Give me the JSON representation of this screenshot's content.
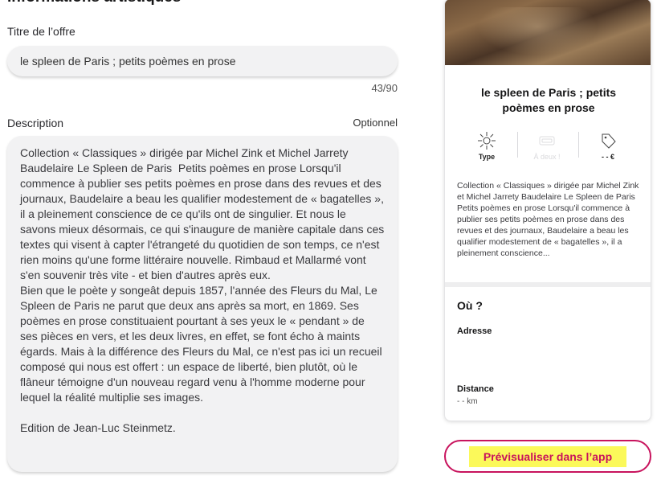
{
  "form": {
    "section_title": "Informations artistiques",
    "title_label": "Titre de l’offre",
    "title_value": "le spleen de Paris ; petits poèmes en prose",
    "title_counter": "43/90",
    "description_label": "Description",
    "description_optional": "Optionnel",
    "description_value": "Collection « Classiques » dirigée par Michel Zink et Michel Jarrety Baudelaire Le Spleen de Paris  Petits poèmes en prose Lorsqu'il commence à publier ses petits poèmes en prose dans des revues et des journaux, Baudelaire a beau les qualifier modestement de « bagatelles », il a pleinement conscience de ce qu'ils ont de singulier. Et nous le savons mieux désormais, ce qui s'inaugure de manière capitale dans ces textes qui visent à capter l'étrangeté du quotidien de son temps, ce n'est rien moins qu'une forme littéraire nouvelle. Rimbaud et Mallarmé vont s'en souvenir très vite - et bien d'autres après eux.\nBien que le poète y songeât depuis 1857, l'année des Fleurs du Mal, Le Spleen de Paris ne parut que deux ans après sa mort, en 1869. Ses poèmes en prose constituaient pourtant à ses yeux le « pendant » de ses pièces en vers, et les deux livres, en effet, se font écho à maints égards. Mais à la différence des Fleurs du Mal, ce n'est pas ici un recueil composé qui nous est offert : un espace de liberté, bien plutôt, où le flâneur témoigne d'un nouveau regard venu à l'homme moderne pour lequel la réalité multiplie ses images.\n\nEdition de Jean-Luc Steinmetz."
  },
  "preview": {
    "title": "le spleen de Paris ; petits poèmes en prose",
    "meta": {
      "type_icon": "sparkle-icon",
      "type_label": "Type",
      "duo_icon": "duo-ticket-icon",
      "duo_label": "À deux !",
      "price_icon": "price-tag-icon",
      "price_label": "- - €"
    },
    "description": "Collection « Classiques » dirigée par Michel Zink et Michel Jarrety Baudelaire Le Spleen de Paris Petits poèmes en prose Lorsqu'il commence à publier ses petits poèmes en prose dans des revues et des journaux, Baudelaire a beau les qualifier modestement de « bagatelles », il a pleinement conscience...",
    "where_title": "Où ?",
    "address_label": "Adresse",
    "distance_label": "Distance",
    "distance_value": "- - km"
  },
  "actions": {
    "preview_button": "Prévisualiser dans l’app"
  },
  "colors": {
    "accent": "#c8135d",
    "highlight": "#fbf95a"
  }
}
